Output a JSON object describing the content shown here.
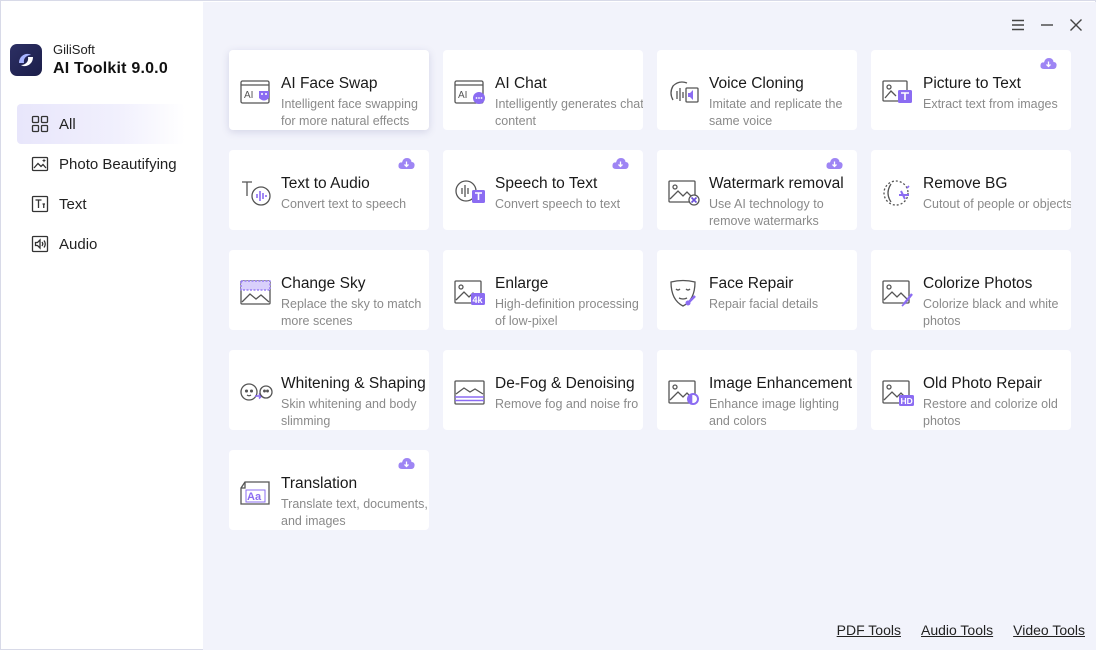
{
  "brand": {
    "company": "GiliSoft",
    "product": "AI Toolkit 9.0.0"
  },
  "nav": [
    {
      "label": "All",
      "icon": "grid-icon",
      "active": true
    },
    {
      "label": "Photo Beautifying",
      "icon": "photo-icon"
    },
    {
      "label": "Text",
      "icon": "text-icon"
    },
    {
      "label": "Audio",
      "icon": "audio-icon"
    }
  ],
  "window_controls": [
    "menu-icon",
    "minimize-icon",
    "close-icon"
  ],
  "tools": [
    {
      "title": "AI Face Swap",
      "desc": "Intelligent face swapping for more natural effects",
      "icon": "face-swap-icon"
    },
    {
      "title": "AI Chat",
      "desc": "Intelligently generates chat content",
      "icon": "ai-chat-icon"
    },
    {
      "title": "Voice Cloning",
      "desc": "Imitate and replicate the same voice",
      "icon": "voice-clone-icon"
    },
    {
      "title": "Picture to Text",
      "desc": "Extract text from images",
      "icon": "picture-text-icon",
      "download": true
    },
    {
      "title": "Text to Audio",
      "desc": "Convert text to speech",
      "icon": "text-audio-icon",
      "download": true
    },
    {
      "title": "Speech to Text",
      "desc": "Convert speech to text",
      "icon": "speech-text-icon",
      "download": true
    },
    {
      "title": "Watermark removal",
      "desc": "Use AI technology to remove watermarks",
      "icon": "watermark-icon",
      "download": true
    },
    {
      "title": "Remove BG",
      "desc": "Cutout of people or objects",
      "icon": "remove-bg-icon"
    },
    {
      "title": "Change Sky",
      "desc": "Replace the sky to match more scenes",
      "icon": "change-sky-icon"
    },
    {
      "title": "Enlarge",
      "desc": "High-definition processing of low-pixel",
      "icon": "enlarge-icon"
    },
    {
      "title": "Face Repair",
      "desc": "Repair facial details",
      "icon": "face-repair-icon"
    },
    {
      "title": "Colorize Photos",
      "desc": "Colorize black and white photos",
      "icon": "colorize-icon"
    },
    {
      "title": "Whitening & Shaping",
      "desc": "Skin whitening and body slimming",
      "icon": "whitening-icon"
    },
    {
      "title": "De-Fog & Denoising",
      "desc": "Remove fog and noise fro",
      "icon": "defog-icon"
    },
    {
      "title": "Image Enhancement",
      "desc": "Enhance image lighting and colors",
      "icon": "enhance-icon"
    },
    {
      "title": "Old Photo Repair",
      "desc": "Restore and colorize old photos",
      "icon": "old-photo-icon"
    },
    {
      "title": "Translation",
      "desc": "Translate text, documents, and images",
      "icon": "translation-icon",
      "download": true
    }
  ],
  "footer": {
    "pdf": "PDF Tools",
    "audio": "Audio Tools",
    "video": "Video Tools"
  },
  "colors": {
    "accent": "#8b6cf2",
    "sidebar_active": "#e8e6fb",
    "main_bg": "#f2f3fb"
  }
}
